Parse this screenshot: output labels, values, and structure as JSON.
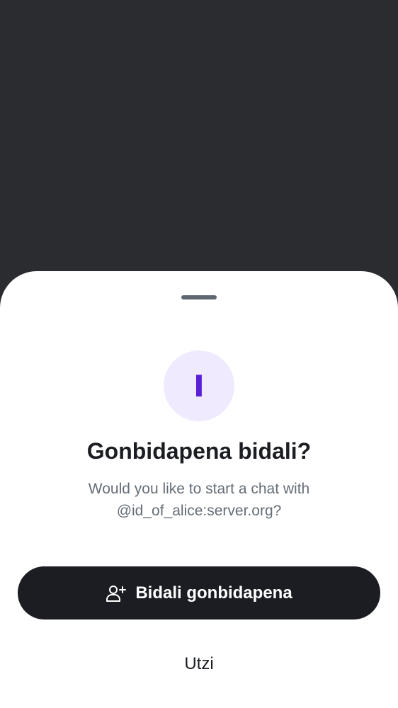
{
  "dialog": {
    "avatar_letter": "I",
    "title": "Gonbidapena bidali?",
    "message": "Would you like to start a chat with @id_of_alice:server.org?",
    "primary_button": {
      "label": "Bidali gonbidapena",
      "icon": "user-add-icon"
    },
    "secondary_button": {
      "label": "Utzi"
    }
  },
  "colors": {
    "backdrop": "#2b2c2f",
    "sheet": "#ffffff",
    "avatar_bg": "#efeafd",
    "avatar_fg": "#5a20d6",
    "primary_button_bg": "#1b1d22",
    "text_primary": "#1b1d22",
    "text_secondary": "#656d77"
  }
}
